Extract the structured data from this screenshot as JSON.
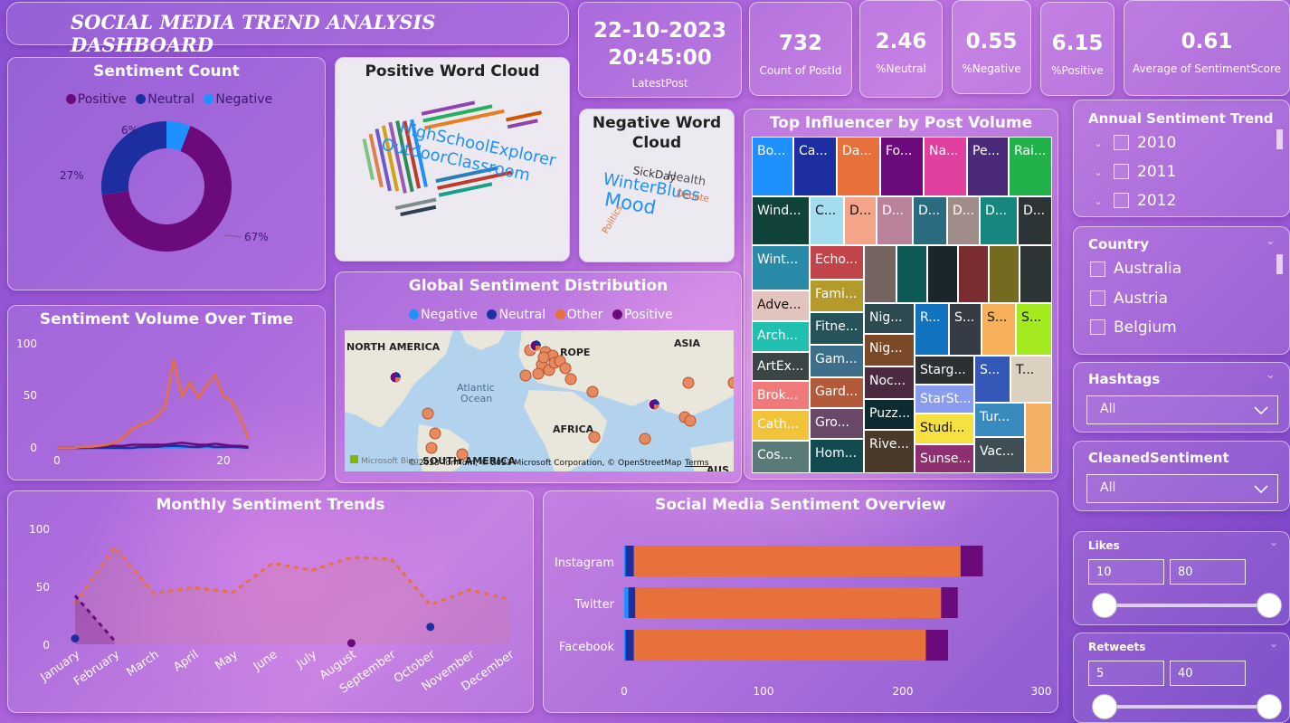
{
  "header": {
    "title": "SOCIAL MEDIA TREND ANALYSIS DASHBOARD"
  },
  "kpis": {
    "latest_date": "22-10-2023",
    "latest_time": "20:45:00",
    "latest_label": "LatestPost",
    "count_value": "732",
    "count_label": "Count of PostId",
    "neutral_value": "2.46",
    "neutral_label": "%Neutral",
    "negative_value": "0.55",
    "negative_label": "%Negative",
    "positive_value": "6.15",
    "positive_label": "%Positive",
    "avg_value": "0.61",
    "avg_label": "Average of SentimentScore"
  },
  "colors": {
    "positive": "#6b0a7a",
    "neutral": "#1d2ea0",
    "negative": "#1e90ff",
    "other": "#e8703a"
  },
  "sentiment_count": {
    "title": "Sentiment Count",
    "legend": [
      "Positive",
      "Neutral",
      "Negative"
    ],
    "labels": {
      "negative": "6%",
      "neutral": "27%",
      "positive": "67%"
    }
  },
  "wordcloud_pos": {
    "title": "Positive Word Cloud",
    "big1": "HighSchoolExplorer",
    "big2": "OutdoorClassroom"
  },
  "wordcloud_neg": {
    "title_line1": "Negative Word",
    "title_line2": "Cloud",
    "w1": "WinterBlues",
    "w2": "Mood",
    "w3": "SickDay",
    "w4": "Health",
    "w5": "Debate",
    "w6": "Politics"
  },
  "treemap": {
    "title": "Top Influencer by Post Volume",
    "tiles": [
      "Bo...",
      "Ca...",
      "Da...",
      "Fo...",
      "Na...",
      "Pe...",
      "Rai...",
      "Wind...",
      "C...",
      "D...",
      "D...",
      "D...",
      "D...",
      "D...",
      "D...",
      "Wint...",
      "Echo...",
      "Adve...",
      "Fami...",
      "Nig...",
      "R...",
      "S...",
      "S...",
      "S...",
      "Arch...",
      "Fitne...",
      "Nig...",
      "Starg...",
      "S...",
      "T...",
      "ArtEx...",
      "Gam...",
      "StarSt...",
      "Brok...",
      "Gard...",
      "Noc...",
      "Tur...",
      "Cath...",
      "Gro...",
      "Puzz...",
      "Studi...",
      "Cos...",
      "Hom...",
      "Rive...",
      "Sunse...",
      "Vac..."
    ]
  },
  "volume_over_time": {
    "title": "Sentiment Volume Over Time",
    "y_ticks": [
      "100",
      "50",
      "0"
    ],
    "x_ticks": [
      "0",
      "20"
    ]
  },
  "map": {
    "title": "Global Sentiment Distribution",
    "legend": [
      "Negative",
      "Neutral",
      "Other",
      "Positive"
    ],
    "labels": {
      "north_america": "NORTH AMERICA",
      "europe": "ROPE",
      "asia": "ASIA",
      "atlantic1": "Atlantic",
      "atlantic2": "Ocean",
      "africa": "AFRICA",
      "south_america": "SOUTH AMERICA",
      "aus": "AUS",
      "ocean": "Ocean"
    },
    "attribution": "© 2023 TomTom, © 2023 Microsoft Corporation, © OpenStreetMap",
    "terms": "Terms",
    "bing": "Microsoft Bing"
  },
  "monthly": {
    "title": "Monthly Sentiment Trends",
    "y_ticks": [
      "100",
      "50",
      "0"
    ],
    "months": [
      "January",
      "February",
      "March",
      "April",
      "May",
      "June",
      "July",
      "August",
      "September",
      "October",
      "November",
      "December"
    ]
  },
  "overview": {
    "title": "Social Media Sentiment Overview",
    "platforms": [
      "Instagram",
      "Twitter",
      "Facebook"
    ],
    "x_ticks": [
      "0",
      "100",
      "200",
      "300"
    ]
  },
  "chart_data": [
    {
      "type": "pie",
      "title": "Sentiment Count",
      "categories": [
        "Positive",
        "Neutral",
        "Negative"
      ],
      "values": [
        67,
        27,
        6
      ],
      "legend": "top"
    },
    {
      "type": "line",
      "title": "Sentiment Volume Over Time",
      "x": [
        0,
        1,
        2,
        3,
        4,
        5,
        6,
        7,
        8,
        9,
        10,
        11,
        12,
        13,
        14,
        15,
        16,
        17,
        18,
        19,
        20,
        21,
        22,
        23
      ],
      "xlim": [
        0,
        23
      ],
      "ylim": [
        0,
        110
      ],
      "series": [
        {
          "name": "Other",
          "values": [
            0,
            0,
            0,
            1,
            1,
            2,
            3,
            5,
            10,
            18,
            22,
            25,
            30,
            40,
            85,
            50,
            63,
            48,
            60,
            70,
            50,
            45,
            30,
            8
          ]
        },
        {
          "name": "Positive",
          "values": [
            0,
            0,
            0,
            0,
            1,
            1,
            2,
            2,
            2,
            3,
            3,
            3,
            3,
            3,
            4,
            5,
            4,
            3,
            3,
            4,
            3,
            2,
            2,
            1
          ]
        },
        {
          "name": "Neutral",
          "values": [
            0,
            0,
            0,
            0,
            0,
            0,
            0,
            0,
            0,
            0,
            1,
            1,
            1,
            2,
            2,
            2,
            1,
            1,
            2,
            1,
            1,
            1,
            1,
            0
          ]
        },
        {
          "name": "Negative",
          "values": [
            0,
            0,
            0,
            0,
            0,
            0,
            0,
            0,
            0,
            0,
            0,
            0,
            1,
            0,
            1,
            0,
            1,
            0,
            1,
            0,
            0,
            1,
            0,
            0
          ]
        }
      ]
    },
    {
      "type": "area",
      "title": "Monthly Sentiment Trends",
      "categories": [
        "January",
        "February",
        "March",
        "April",
        "May",
        "June",
        "July",
        "August",
        "September",
        "October",
        "November",
        "December"
      ],
      "ylim": [
        0,
        110
      ],
      "series": [
        {
          "name": "Other",
          "values": [
            35,
            84,
            44,
            49,
            45,
            70,
            64,
            75,
            74,
            34,
            47,
            39
          ]
        },
        {
          "name": "Positive",
          "values": [
            42,
            3,
            null,
            null,
            null,
            null,
            null,
            1,
            null,
            null,
            null,
            null
          ]
        },
        {
          "name": "Neutral",
          "values": [
            5,
            null,
            null,
            null,
            null,
            null,
            null,
            null,
            null,
            15,
            null,
            null
          ]
        }
      ]
    },
    {
      "type": "bar",
      "title": "Social Media Sentiment Overview",
      "orientation": "horizontal",
      "stacked": true,
      "categories": [
        "Instagram",
        "Twitter",
        "Facebook"
      ],
      "xlim": [
        0,
        300
      ],
      "series": [
        {
          "name": "Negative",
          "values": [
            1,
            3,
            1
          ]
        },
        {
          "name": "Neutral",
          "values": [
            6,
            5,
            6
          ]
        },
        {
          "name": "Other",
          "values": [
            235,
            220,
            210
          ]
        },
        {
          "name": "Positive",
          "values": [
            16,
            12,
            16
          ]
        }
      ]
    }
  ],
  "slicers": {
    "annual": {
      "title": "Annual Sentiment Trend",
      "options": [
        "2010",
        "2011",
        "2012"
      ]
    },
    "country": {
      "title": "Country",
      "options": [
        "Australia",
        "Austria",
        "Belgium"
      ]
    },
    "hashtags": {
      "title": "Hashtags",
      "value": "All"
    },
    "cleaned": {
      "title": "CleanedSentiment",
      "value": "All"
    },
    "likes": {
      "title": "Likes",
      "min": "10",
      "max": "80"
    },
    "retweets": {
      "title": "Retweets",
      "min": "5",
      "max": "40"
    }
  }
}
